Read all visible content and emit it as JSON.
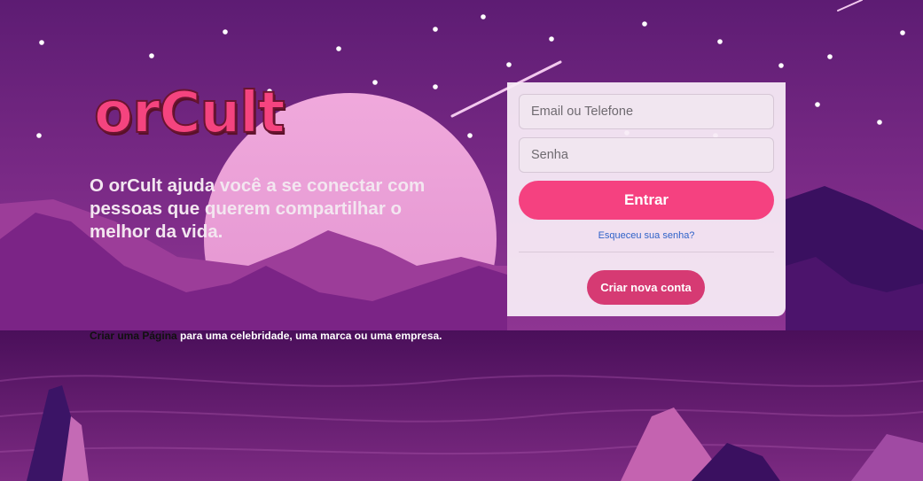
{
  "brand": {
    "logo": "orCult"
  },
  "hero": {
    "tagline": "O orCult ajuda você a se conectar com pessoas que querem compartilhar o melhor da vida."
  },
  "login": {
    "email_placeholder": "Email ou Telefone",
    "password_placeholder": "Senha",
    "submit_label": "Entrar",
    "forgot_label": "Esqueceu sua senha?",
    "create_label": "Criar nova conta"
  },
  "footer": {
    "page_link": "Criar uma Página",
    "page_text": " para uma celebridade, uma marca ou uma empresa."
  },
  "colors": {
    "accent": "#f54180",
    "create_button": "#d63a73",
    "link": "#2f62c8",
    "background": "#5a1a70"
  }
}
